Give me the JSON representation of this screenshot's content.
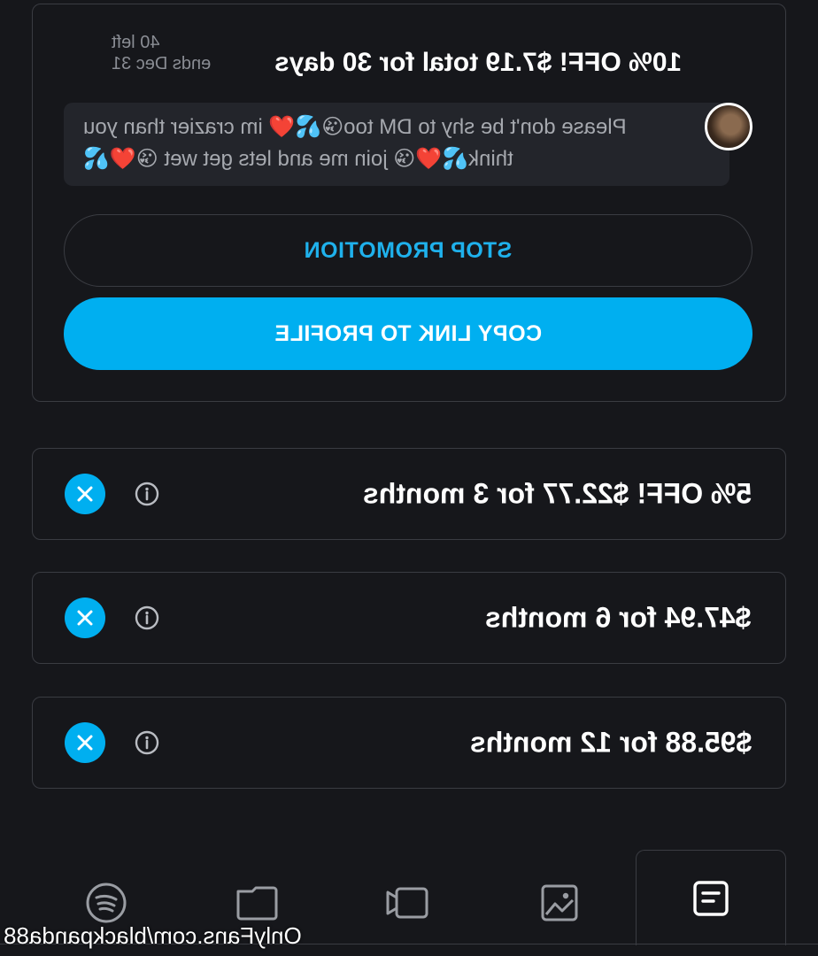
{
  "promotion": {
    "title": "10% OFF! $7.19 total for 30 days",
    "remaining": "40 left",
    "ends": "ends Dec 31",
    "message_line1": "Please don't be shy to DM too😘💦❤️ im crazier than you",
    "message_line2": "think💦❤️😘 join me and lets get wet 😘❤️💦",
    "stop_label": "STOP PROMOTION",
    "copy_label": "COPY LINK TO PROFILE"
  },
  "bundles": [
    {
      "label": "5% OFF!   $22.77 for 3 months"
    },
    {
      "label": "$47.94 for 6 months"
    },
    {
      "label": "$95.88 for 12 months"
    }
  ],
  "bottom_nav": {
    "tabs": [
      {
        "icon": "spotify-icon"
      },
      {
        "icon": "folder-icon"
      },
      {
        "icon": "video-icon"
      },
      {
        "icon": "image-icon"
      },
      {
        "icon": "post-icon",
        "active": true
      }
    ]
  },
  "watermark": "OnlyFans.com/blackpanda88",
  "colors": {
    "accent": "#00aff0",
    "background": "#16171b",
    "border": "#3a3c42"
  }
}
